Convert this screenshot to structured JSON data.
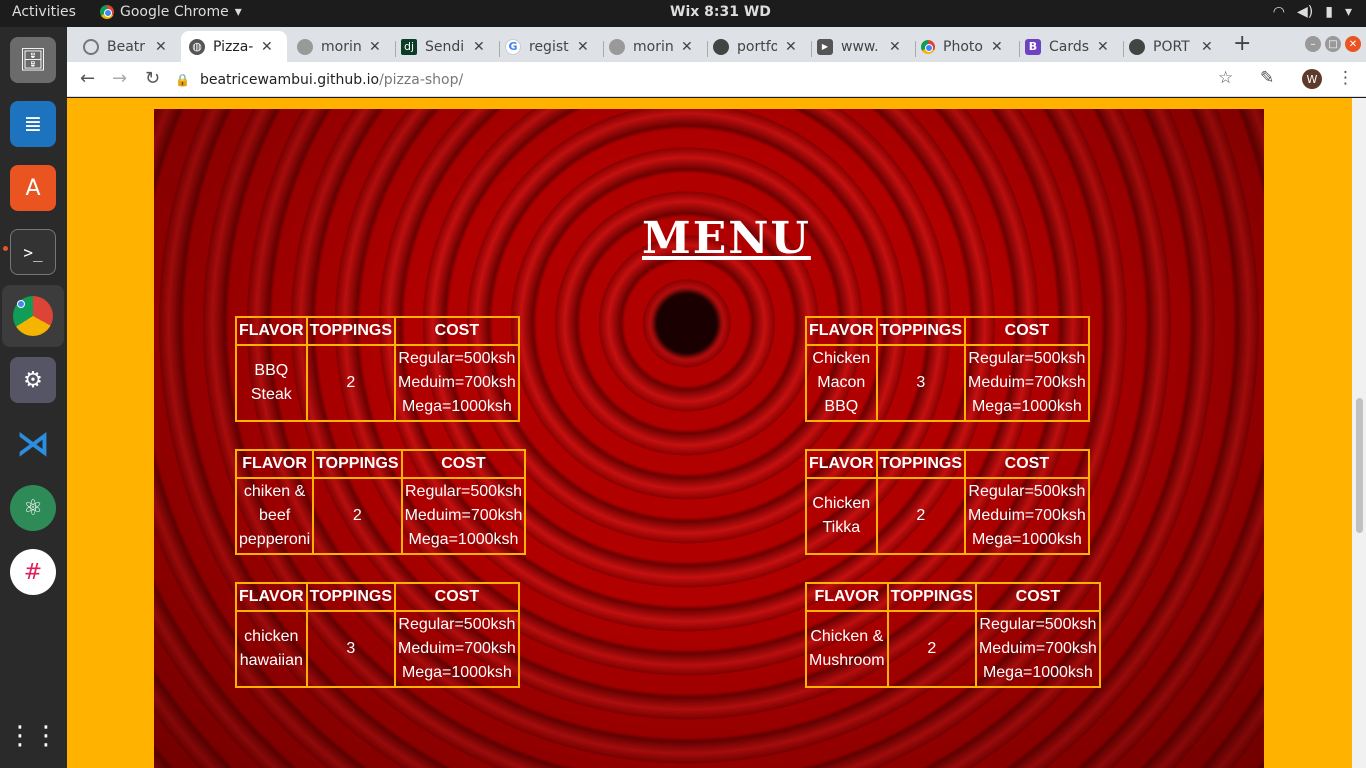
{
  "topbar": {
    "activities": "Activities",
    "app_name": "Google Chrome",
    "clock": "Wix  8:31 WD"
  },
  "tabs": [
    {
      "title": "Beatr",
      "favicon": "loading-icon"
    },
    {
      "title": "Pizza-",
      "favicon": "globe-icon"
    },
    {
      "title": "morin",
      "favicon": "github-icon"
    },
    {
      "title": "Sendi",
      "favicon": "django-icon"
    },
    {
      "title": "regist",
      "favicon": "google-icon"
    },
    {
      "title": "morin",
      "favicon": "github-icon"
    },
    {
      "title": "portfo",
      "favicon": "github-icon"
    },
    {
      "title": "www.",
      "favicon": "youtube-icon"
    },
    {
      "title": "Photo",
      "favicon": "chrome-icon"
    },
    {
      "title": "Cards",
      "favicon": "bootstrap-icon"
    },
    {
      "title": "PORT",
      "favicon": "github-icon"
    }
  ],
  "toolbar": {
    "url_host": "beatricewambui.github.io",
    "url_path": "/pizza-shop/",
    "avatar_letter": "W"
  },
  "page": {
    "title": "MENU",
    "headers": {
      "flavor": "FLAVOR",
      "toppings": "TOPPINGS",
      "cost": "COST"
    },
    "cost_regular": "Regular=500ksh",
    "cost_medium": "Meduim=700ksh",
    "cost_mega": "Mega=1000ksh",
    "pizzas": [
      {
        "flavor_l1": "BBQ",
        "flavor_l2": "Steak",
        "flavor_l3": "",
        "toppings": "2"
      },
      {
        "flavor_l1": "Chicken",
        "flavor_l2": "Macon",
        "flavor_l3": "BBQ",
        "toppings": "3"
      },
      {
        "flavor_l1": "chiken &",
        "flavor_l2": "beef",
        "flavor_l3": "pepperoni",
        "toppings": "2"
      },
      {
        "flavor_l1": "Chicken",
        "flavor_l2": "Tikka",
        "flavor_l3": "",
        "toppings": "2"
      },
      {
        "flavor_l1": "chicken",
        "flavor_l2": "hawaiian",
        "flavor_l3": "",
        "toppings": "3"
      },
      {
        "flavor_l1": "Chicken &",
        "flavor_l2": "Mushroom",
        "flavor_l3": "",
        "toppings": "2"
      }
    ]
  },
  "colors": {
    "page_bg": "#ffb300",
    "table_border": "#ffb300",
    "rose": "#b00000"
  }
}
